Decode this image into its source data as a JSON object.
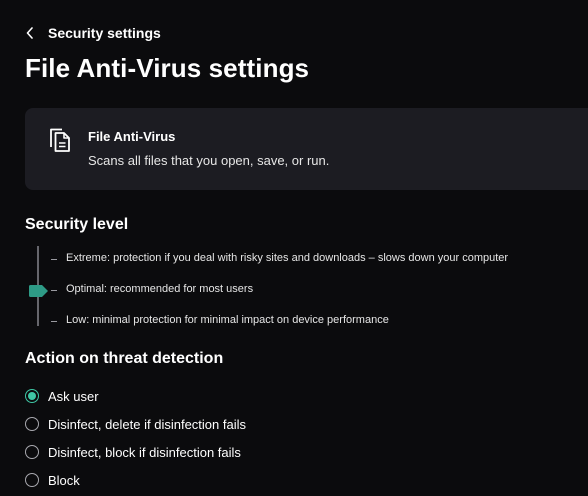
{
  "header": {
    "back_label": "Security settings",
    "title": "File Anti-Virus settings"
  },
  "feature_card": {
    "icon": "documents-icon",
    "title": "File Anti-Virus",
    "description": "Scans all files that you open, save, or run."
  },
  "security_level": {
    "title": "Security level",
    "selected": "Optimal",
    "accent_color": "#2e9b86",
    "levels": [
      {
        "name": "Extreme",
        "description": ": protection if you deal with risky sites and downloads – slows down your computer"
      },
      {
        "name": "Optimal",
        "description": ": recommended for most users"
      },
      {
        "name": "Low",
        "description": ": minimal protection for minimal impact on device performance"
      }
    ]
  },
  "threat_action": {
    "title": "Action on threat detection",
    "selected_index": 0,
    "accent_color": "#3fc7a5",
    "options": [
      {
        "label": "Ask user"
      },
      {
        "label": "Disinfect, delete if disinfection fails"
      },
      {
        "label": "Disinfect, block if disinfection fails"
      },
      {
        "label": "Block"
      }
    ]
  }
}
